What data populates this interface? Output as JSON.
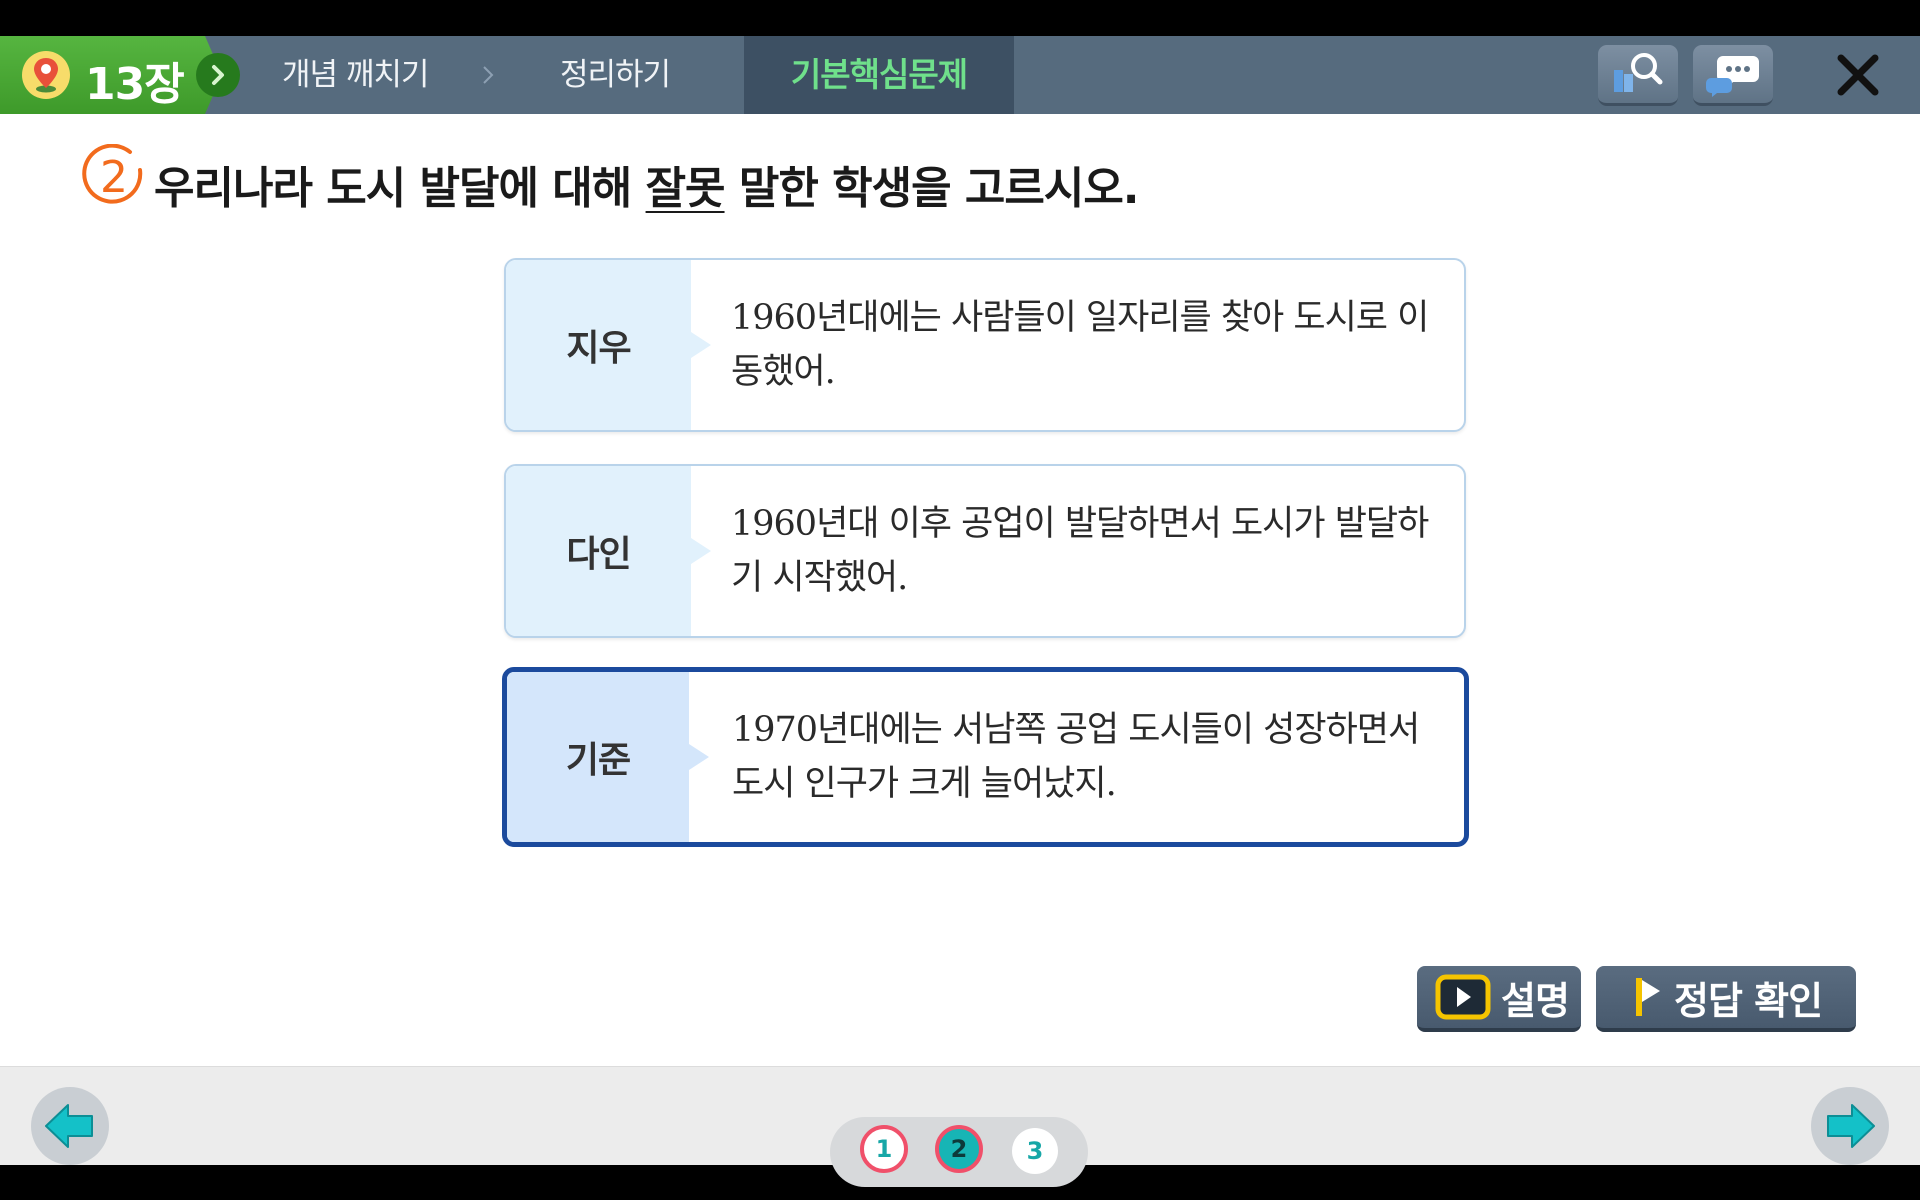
{
  "header": {
    "chapter": "13장",
    "breadcrumbs": [
      "개념 깨치기",
      "정리하기"
    ],
    "active_tab": "기본핵심문제"
  },
  "question": {
    "number": "2",
    "text_before": "우리나라 도시 발달에 대해 ",
    "text_underlined": "잘못",
    "text_after": " 말한 학생을 고르시오."
  },
  "choices": [
    {
      "name": "지우",
      "statement": "1960년대에는 사람들이 일자리를 찾아 도시로 이동했어.",
      "selected": false
    },
    {
      "name": "다인",
      "statement": "1960년대 이후 공업이 발달하면서 도시가 발달하기 시작했어.",
      "selected": false
    },
    {
      "name": "기준",
      "statement": "1970년대에는 서남쪽 공업 도시들이 성장하면서 도시 인구가 크게 늘어났지.",
      "selected": true
    }
  ],
  "actions": {
    "explain_label": "설명",
    "answer_label": "정답 확인"
  },
  "pager": {
    "pages": [
      "1",
      "2",
      "3"
    ],
    "current": "2"
  },
  "colors": {
    "chapter_green": "#4caf3a",
    "active_tab_text": "#6fe08b",
    "selected_border": "#1b4a9d",
    "question_number": "#f26b1d",
    "pager_teal": "#17b5b5"
  },
  "icons": {
    "chapter": "map-pin-icon",
    "search": "book-search-icon",
    "chat": "chat-bubble-icon",
    "close": "close-icon",
    "prev": "arrow-left-icon",
    "next": "arrow-right-icon",
    "play": "play-icon",
    "flag": "flag-icon"
  }
}
